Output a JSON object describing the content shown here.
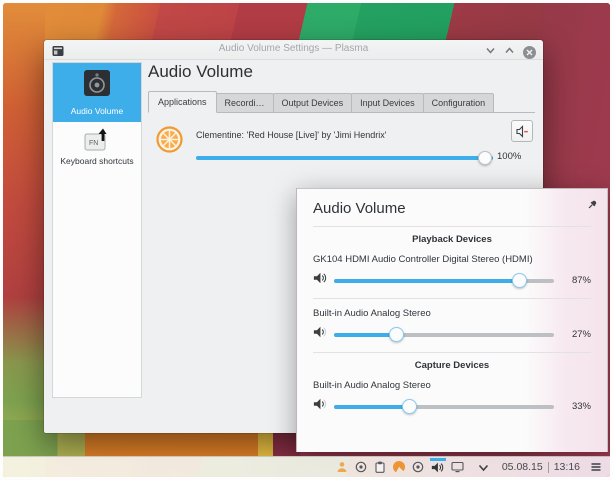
{
  "colors": {
    "accent": "#3daee9",
    "window_bg": "#eff0f1",
    "text": "#31363b",
    "selection": "#3daee9"
  },
  "settings_window": {
    "titlebar": {
      "title": "Audio Volume Settings — Plasma",
      "icons": [
        "app-window-icon",
        "minimize-chevron-icon",
        "maximize-chevron-icon",
        "close-circle-icon"
      ]
    },
    "sidebar": {
      "items": [
        {
          "label": "Audio Volume",
          "icon": "speaker-box-icon",
          "selected": true
        },
        {
          "label": "Keyboard shortcuts",
          "icon": "fn-key-arrow-icon",
          "selected": false
        }
      ]
    },
    "content": {
      "heading": "Audio Volume",
      "tabs": [
        {
          "label": "Applications",
          "active": true
        },
        {
          "label": "Recordi…",
          "active": false
        },
        {
          "label": "Output Devices",
          "active": false
        },
        {
          "label": "Input Devices",
          "active": false
        },
        {
          "label": "Configuration",
          "active": false
        }
      ],
      "application": {
        "icon": "clementine-orange-icon",
        "title": "Clementine: 'Red House [Live]' by 'Jimi Hendrix'",
        "volume_percent": 100,
        "volume_label": "100%",
        "mute_button_icon": "speaker-mute-icon"
      }
    }
  },
  "popup": {
    "heading": "Audio Volume",
    "pin_icon": "pin-icon",
    "sections": [
      {
        "header": "Playback Devices",
        "devices": [
          {
            "name": "GK104 HDMI Audio Controller Digital Stereo (HDMI)",
            "icon": "speaker-loud-icon",
            "volume_percent": 87,
            "volume_label": "87%"
          },
          {
            "name": "Built-in Audio Analog Stereo",
            "icon": "speaker-low-icon",
            "volume_percent": 27,
            "volume_label": "27%"
          }
        ]
      },
      {
        "header": "Capture Devices",
        "devices": [
          {
            "name": "Built-in Audio Analog Stereo",
            "icon": "speaker-low-icon",
            "volume_percent": 33,
            "volume_label": "33%"
          }
        ]
      }
    ]
  },
  "taskbar": {
    "tray_icons": [
      "user-status-icon",
      "record-circle-icon",
      "clipboard-icon",
      "clementine-tray-icon",
      "disc-icon",
      "audio-volume-tray-icon",
      "display-icon",
      "expand-chevron-icon"
    ],
    "clock_date": "05.08.15",
    "clock_time": "13:16",
    "menu_icon": "hamburger-menu-icon"
  }
}
